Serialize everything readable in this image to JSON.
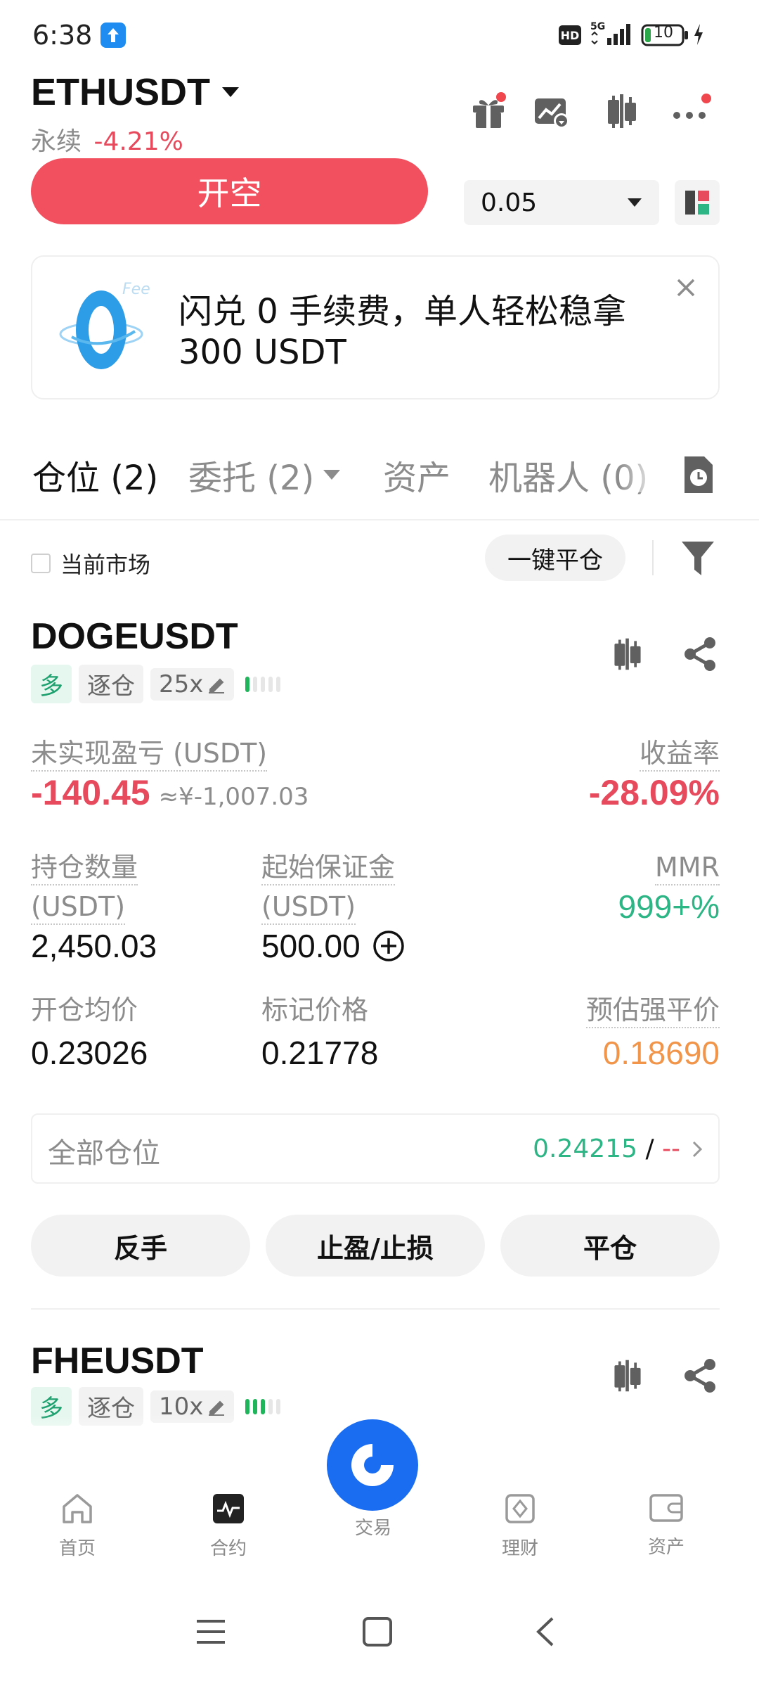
{
  "status_bar": {
    "time": "6:38",
    "battery": "10"
  },
  "header": {
    "pair": "ETHUSDT",
    "type_label": "永续",
    "change": "-4.21%",
    "open_short_label": "开空",
    "quantity_value": "0.05"
  },
  "banner": {
    "logo_text": "0",
    "logo_tag": "Fee",
    "text_line1": "闪兑 0 手续费，单人轻松稳拿",
    "text_line2": "300 USDT"
  },
  "tabs": [
    {
      "label": "仓位 (2)"
    },
    {
      "label": "委托 (2)"
    },
    {
      "label": "资产"
    },
    {
      "label": "机器人 (0)"
    }
  ],
  "filter": {
    "current_market_label": "当前市场",
    "close_all_label": "一键平仓"
  },
  "positions": [
    {
      "symbol": "DOGEUSDT",
      "side": "多",
      "margin_mode": "逐仓",
      "leverage": "25x",
      "unrealized_label": "未实现盈亏 (USDT)",
      "unrealized_value": "-140.45",
      "unrealized_cny": "≈¥-1,007.03",
      "roe_label": "收益率",
      "roe_value": "-28.09%",
      "size_label_1": "持仓数量",
      "size_label_2": "(USDT)",
      "size_value": "2,450.03",
      "margin_label_1": "起始保证金",
      "margin_label_2": "(USDT)",
      "margin_value": "500.00",
      "mmr_label": "MMR",
      "mmr_value": "999+%",
      "entry_label": "开仓均价",
      "entry_value": "0.23026",
      "mark_label": "标记价格",
      "mark_value": "0.21778",
      "liq_label": "预估强平价",
      "liq_value": "0.18690",
      "all_pos_label": "全部仓位",
      "all_pos_value": "0.24215",
      "all_pos_sep": " / ",
      "all_pos_dash": "--",
      "btn_reverse": "反手",
      "btn_tpsl": "止盈/止损",
      "btn_close": "平仓",
      "risk_level": 1,
      "risk_segments": 5
    },
    {
      "symbol": "FHEUSDT",
      "side": "多",
      "margin_mode": "逐仓",
      "leverage": "10x",
      "risk_level": 3,
      "risk_segments": 5
    }
  ],
  "bottom_nav": [
    {
      "label": "首页",
      "icon": "home-icon"
    },
    {
      "label": "合约",
      "icon": "futures-icon"
    },
    {
      "label": "交易",
      "icon": "trade-logo-icon"
    },
    {
      "label": "理财",
      "icon": "earn-icon"
    },
    {
      "label": "资产",
      "icon": "wallet-icon"
    }
  ],
  "colors": {
    "red": "#e64a5c",
    "green": "#2db586",
    "orange": "#f0954a",
    "brand_blue": "#1a6cf0"
  }
}
